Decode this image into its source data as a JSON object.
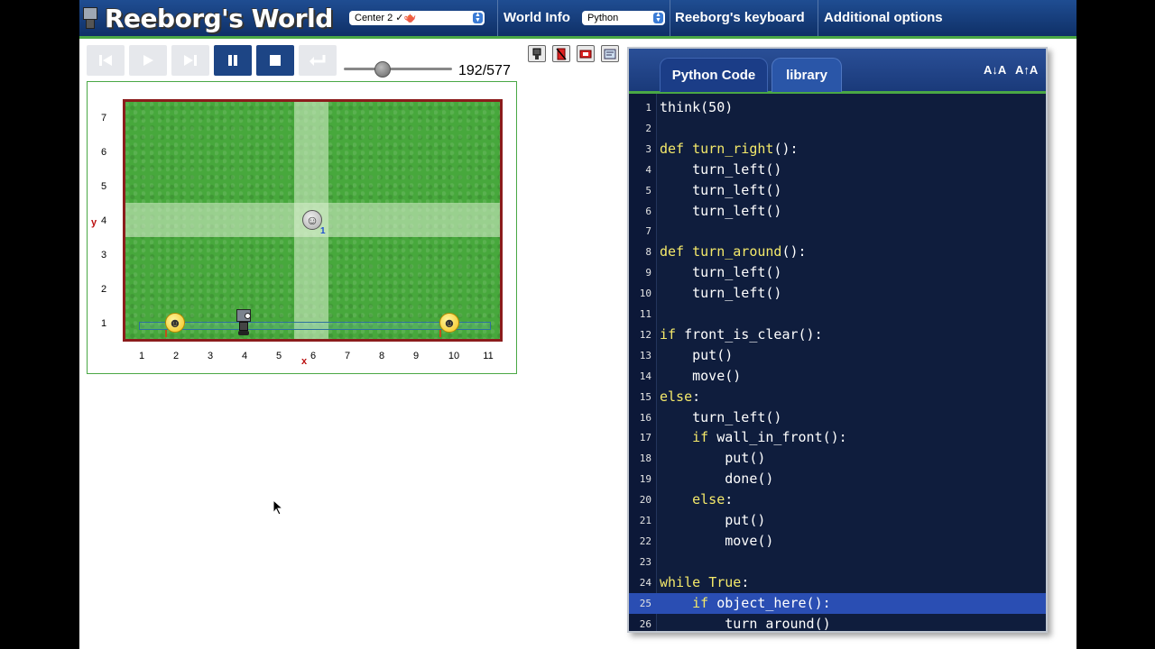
{
  "app": {
    "title": "Reeborg's World"
  },
  "header": {
    "world_select": "Center 2 ✓🫖",
    "world_info": "World Info",
    "language_select": "Python",
    "keyboard": "Reeborg's keyboard",
    "additional_options": "Additional options"
  },
  "controls": {
    "buttons": [
      "reload",
      "run",
      "step",
      "pause",
      "stop",
      "return"
    ],
    "step_counter": "192/577",
    "speed_level": 0.35
  },
  "world": {
    "y_axis_label": "y",
    "x_axis_label": "x",
    "y_ticks": [
      "7",
      "6",
      "5",
      "4",
      "3",
      "2",
      "1"
    ],
    "x_ticks": [
      "1",
      "2",
      "3",
      "4",
      "5",
      "6",
      "7",
      "8",
      "9",
      "10",
      "11"
    ],
    "objects": [
      {
        "name": "token",
        "count": "1"
      }
    ],
    "colors": {
      "grass": "#47a83c",
      "wall": "#8b1c1c",
      "lane": "#d8efd0"
    }
  },
  "editor": {
    "tabs": [
      "Python Code",
      "library"
    ],
    "font_smaller": "A↓A",
    "font_larger": "A↑A",
    "highlight_line": 25,
    "lines": [
      "think(50)",
      "",
      "def turn_right():",
      "    turn_left()",
      "    turn_left()",
      "    turn_left()",
      "",
      "def turn_around():",
      "    turn_left()",
      "    turn_left()",
      "",
      "if front_is_clear():",
      "    put()",
      "    move()",
      "else:",
      "    turn_left()",
      "    if wall_in_front():",
      "        put()",
      "        done()",
      "    else:",
      "        put()",
      "        move()",
      "",
      "while True:",
      "    if object_here():",
      "        turn_around()"
    ]
  }
}
